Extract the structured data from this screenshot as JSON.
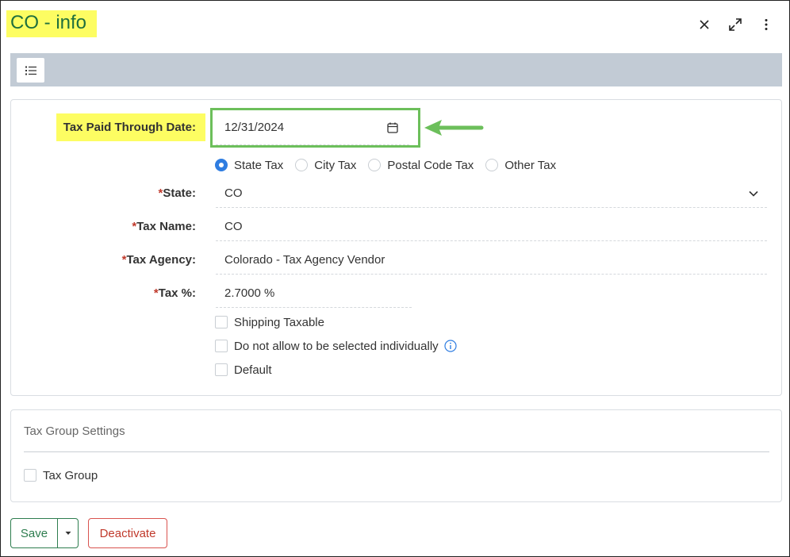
{
  "header": {
    "title": "CO - info"
  },
  "form": {
    "tax_paid_through_date": {
      "label": "Tax Paid Through Date:",
      "value": "12/31/2024"
    },
    "tax_type": {
      "options": [
        "State Tax",
        "City Tax",
        "Postal Code Tax",
        "Other Tax"
      ],
      "selected": "State Tax"
    },
    "state": {
      "required": "*",
      "label": "State:",
      "value": "CO"
    },
    "tax_name": {
      "required": "*",
      "label": "Tax Name:",
      "value": "CO"
    },
    "tax_agency": {
      "required": "*",
      "label": "Tax Agency:",
      "value": "Colorado - Tax Agency Vendor"
    },
    "tax_percent": {
      "required": "*",
      "label": "Tax %:",
      "value": "2.7000 %"
    },
    "checkboxes": {
      "shipping_taxable": "Shipping Taxable",
      "not_individually": "Do not allow to be selected individually",
      "default": "Default"
    }
  },
  "tax_group_settings": {
    "title": "Tax Group Settings",
    "tax_group_label": "Tax Group"
  },
  "footer": {
    "save_label": "Save",
    "deactivate_label": "Deactivate"
  },
  "colors": {
    "highlight": "#fdfd62",
    "title_green": "#1f6f3d",
    "arrow_green": "#6cbf5b",
    "radio_blue": "#2f7de1",
    "save_green": "#2e7d4f",
    "deactivate_red": "#c0392b",
    "toolbar_gray": "#c2cbd5"
  },
  "icons": [
    "close-icon",
    "expand-icon",
    "more-vertical-icon",
    "list-icon",
    "calendar-icon",
    "chevron-down-icon",
    "info-icon",
    "caret-down-icon",
    "arrow-left-icon"
  ]
}
